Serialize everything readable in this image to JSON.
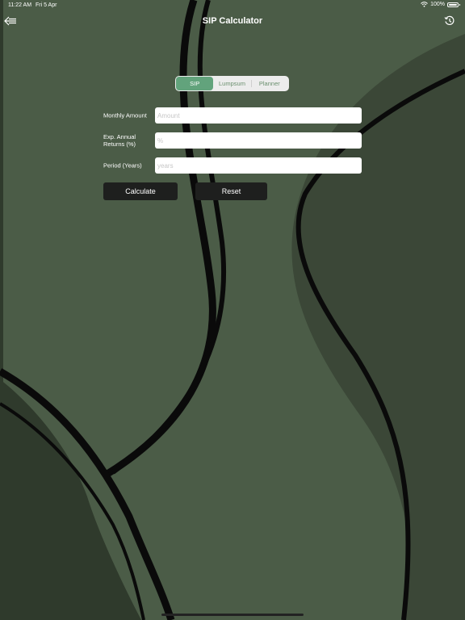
{
  "status": {
    "time": "11:22 AM",
    "date": "Fri 5 Apr",
    "battery_text": "100%",
    "battery_level": 1.0
  },
  "nav": {
    "title": "SIP Calculator"
  },
  "tabs": [
    {
      "label": "SIP",
      "active": true
    },
    {
      "label": "Lumpsum",
      "active": false
    },
    {
      "label": "Planner",
      "active": false
    }
  ],
  "form": {
    "monthly_label": "Monthly Amount",
    "monthly_placeholder": "Amount",
    "monthly_value": "",
    "returns_label": "Exp. Annual Returns (%)",
    "returns_placeholder": "%",
    "returns_value": "",
    "period_label": "Period (Years)",
    "period_placeholder": "years",
    "period_value": ""
  },
  "buttons": {
    "calculate": "Calculate",
    "reset": "Reset"
  },
  "colors": {
    "background": "#4b5c47",
    "dark_shape": "#3b4737",
    "darker_shape": "#2f3a2c",
    "accent": "#62a37c",
    "button": "#1e1f1e"
  },
  "icons": {
    "back": "back-arrow-icon",
    "history": "history-icon",
    "wifi": "wifi-icon",
    "battery": "battery-icon"
  }
}
